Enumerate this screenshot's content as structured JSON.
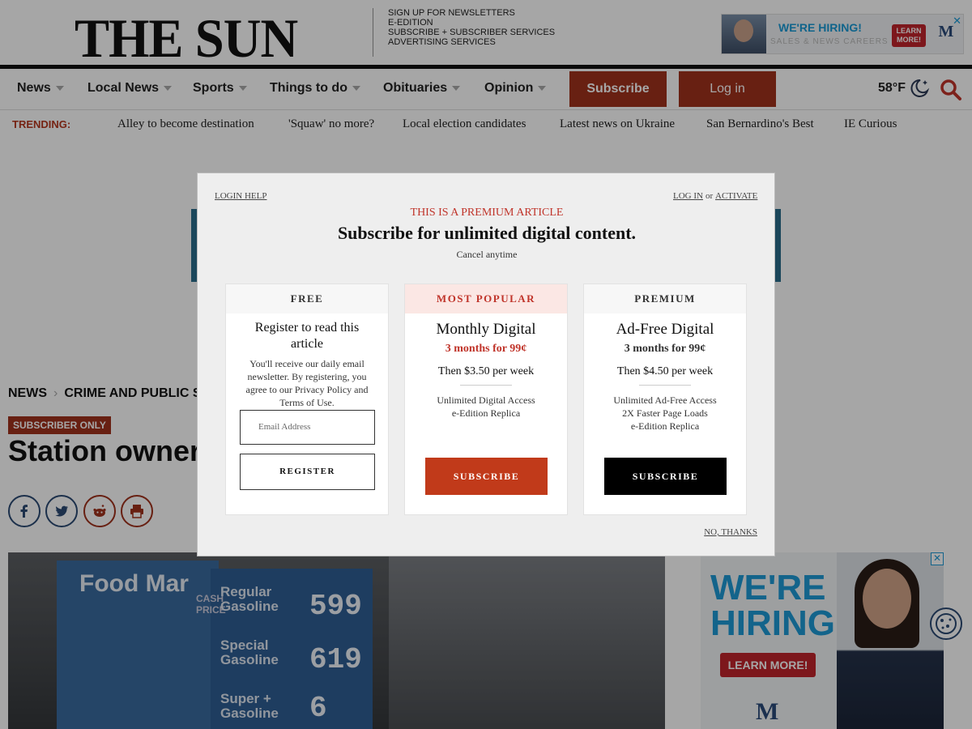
{
  "header": {
    "logo": "THE SUN",
    "top_links": [
      "SIGN UP FOR NEWSLETTERS",
      "E-EDITION",
      "SUBSCRIBE + SUBSCRIBER SERVICES",
      "ADVERTISING SERVICES"
    ],
    "banner_ad": {
      "headline": "WE'RE HIRING!",
      "sub": "SALES & NEWS CAREERS",
      "cta": "LEARN MORE!",
      "logo_letter": "M",
      "close": "✕"
    }
  },
  "nav": {
    "items": [
      "News",
      "Local News",
      "Sports",
      "Things to do",
      "Obituaries",
      "Opinion"
    ],
    "subscribe": "Subscribe",
    "login": "Log in",
    "weather": "58°F"
  },
  "trending": {
    "label": "TRENDING:",
    "links": [
      "Alley to become destination",
      "'Squaw' no more?",
      "Local election candidates",
      "Latest news on Ukraine",
      "San Bernardino's Best",
      "IE Curious"
    ]
  },
  "article": {
    "breadcrumb": [
      "NEWS",
      "CRIME AND PUBLIC SA"
    ],
    "badge": "SUBSCRIBER ONLY",
    "headline": "Station owner",
    "photo": {
      "store_sign": "Food Mar",
      "cash_label": "CASH PRICE",
      "fuels": [
        {
          "name_line1": "Regular",
          "name_line2": "Gasoline",
          "price": "599"
        },
        {
          "name_line1": "Special",
          "name_line2": "Gasoline",
          "price": "619"
        },
        {
          "name_line1": "Super +",
          "name_line2": "Gasoline",
          "price": "6"
        }
      ]
    }
  },
  "side_ad": {
    "headline_line1": "WE'RE",
    "headline_line2": "HIRING!",
    "cta": "LEARN MORE!",
    "logo_letter": "M",
    "close": "✕"
  },
  "modal": {
    "login_help": "LOGIN HELP",
    "log_in": "LOG IN",
    "or": "or",
    "activate": "ACTIVATE",
    "premium_label": "THIS IS A PREMIUM ARTICLE",
    "title": "Subscribe for unlimited digital content.",
    "cancel": "Cancel anytime",
    "free_card": {
      "header": "FREE",
      "title": "Register to read this article",
      "desc_pre": "You'll receive our daily email newsletter. By registering, you agree to our",
      "privacy": "Privacy Policy",
      "and": "and",
      "terms": "Terms of Use",
      "period": ".",
      "email_placeholder": "Email Address",
      "register": "REGISTER"
    },
    "popular_card": {
      "header": "MOST POPULAR",
      "title": "Monthly Digital",
      "price": "3 months for 99¢",
      "then": "Then $3.50 per week",
      "features": [
        "Unlimited Digital Access",
        "e-Edition Replica"
      ],
      "button": "SUBSCRIBE"
    },
    "premium_card": {
      "header": "PREMIUM",
      "title": "Ad-Free Digital",
      "price": "3 months for 99¢",
      "then": "Then $4.50 per week",
      "features": [
        "Unlimited Ad-Free Access",
        "2X Faster Page Loads",
        "e-Edition Replica"
      ],
      "button": "SUBSCRIBE"
    },
    "no_thanks": "NO, THANKS"
  },
  "colors": {
    "brand_red": "#a0321d",
    "accent_red": "#c0342a",
    "nav_blue": "#2b4a73"
  }
}
